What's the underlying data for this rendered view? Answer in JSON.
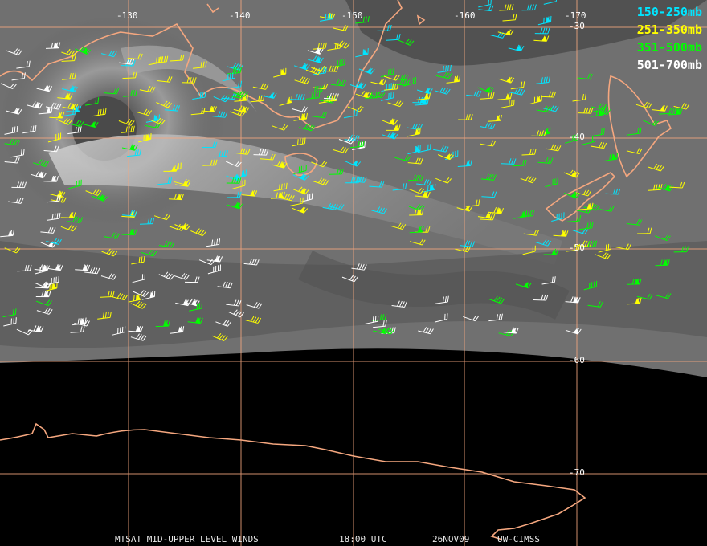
{
  "legend": [
    {
      "label": "150-250mb",
      "color": "#00e5ff"
    },
    {
      "label": "251-350mb",
      "color": "#ffff00"
    },
    {
      "label": "351-500mb",
      "color": "#00ff00"
    },
    {
      "label": "501-700mb",
      "color": "#ffffff"
    }
  ],
  "longitude_labels": [
    "-130",
    "-140",
    "-150",
    "-160",
    "-170"
  ],
  "latitude_labels": [
    "-30",
    "-40",
    "-50",
    "-60",
    "-70"
  ],
  "footer": {
    "product": "MTSAT MID-UPPER LEVEL WINDS",
    "time": "18:00 UTC",
    "date": "26NOV09",
    "source": "UW-CIMSS"
  },
  "colors": {
    "grid": "#f5a77f",
    "coastline": "#f5a77f",
    "space": "#000000"
  }
}
